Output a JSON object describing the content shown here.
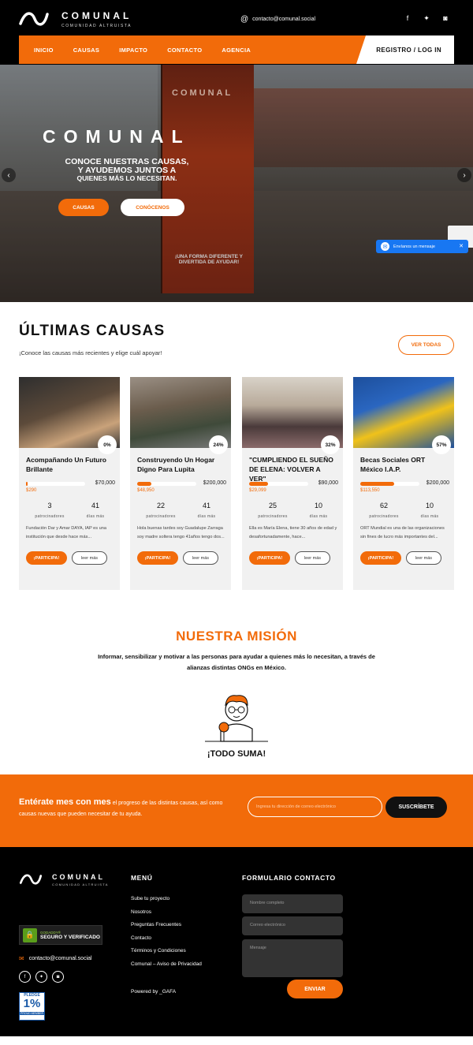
{
  "brand": {
    "name": "COMUNAL",
    "tagline": "COMUNIDAD ALTRUISTA"
  },
  "header": {
    "email": "contacto@comunal.social",
    "socials": [
      "facebook-icon",
      "twitter-icon",
      "instagram-icon"
    ]
  },
  "nav": {
    "items": [
      "INICIO",
      "CAUSAS",
      "IMPACTO",
      "CONTACTO",
      "AGENCIA"
    ],
    "login": "REGISTRO / LOG IN"
  },
  "hero": {
    "brand": "COMUNAL",
    "title_line1": "CONOCE NUESTRAS CAUSAS,",
    "title_line2": "Y AYUDEMOS JUNTOS A",
    "title_line3": "QUIENES MÁS LO NECESITAN.",
    "btn_causas": "CAUSAS",
    "btn_conocenos": "CONÓCENOS",
    "banner_text": "¡UNA FORMA DIFERENTE Y DIVERTIDA DE AYUDAR!"
  },
  "messenger": {
    "label": "Envíanos un mensaje"
  },
  "causes_section": {
    "title": "ÚLTIMAS CAUSAS",
    "subtitle": "¡Conoce las causas más recientes y elige cuál apoyar!",
    "see_all": "VER TODAS"
  },
  "causes": [
    {
      "title": "Acompañando Un Futuro Brillante",
      "percent": 0,
      "percent_label": "0%",
      "goal": "$70,000",
      "raised": "$290",
      "sponsors": "3",
      "sponsors_label": "patrocinadores",
      "days": "41",
      "days_label": "días más",
      "desc": "Fundación Dar y Amar DAYA, IAP es una institución que desde hace más...",
      "btn_participa": "¡PARTICIPA!",
      "btn_leer": "leer más"
    },
    {
      "title": "Construyendo Un Hogar Digno Para Lupita",
      "percent": 24,
      "percent_label": "24%",
      "goal": "$200,000",
      "raised": "$48,950",
      "sponsors": "22",
      "sponsors_label": "patrocinadores",
      "days": "41",
      "days_label": "días más",
      "desc": "Hola buenas tardes soy Guadalupe Zarraga soy madre soltera tengo 41años tengo dos...",
      "btn_participa": "¡PARTICIPA!",
      "btn_leer": "leer más"
    },
    {
      "title": "\"CUMPLIENDO EL SUEÑO DE ELENA: VOLVER A VER\"",
      "percent": 32,
      "percent_label": "32%",
      "goal": "$90,000",
      "raised": "$29,099",
      "sponsors": "25",
      "sponsors_label": "patrocinadores",
      "days": "10",
      "days_label": "días más",
      "desc": "Ella es María Elena, tiene 30 años de edad y desafortunadamente, hace...",
      "btn_participa": "¡PARTICIPA!",
      "btn_leer": "leer más"
    },
    {
      "title": "Becas Sociales ORT México I.A.P.",
      "percent": 57,
      "percent_label": "57%",
      "goal": "$200,000",
      "raised": "$113,550",
      "sponsors": "62",
      "sponsors_label": "patrocinadores",
      "days": "10",
      "days_label": "días más",
      "desc": "ORT Mundial es una de las organizaciones sin fines de lucro más importantes del...",
      "btn_participa": "¡PARTICIPA!",
      "btn_leer": "leer más"
    }
  ],
  "mission": {
    "title": "NUESTRA MISIÓN",
    "text": "Informar, sensibilizar y motivar a las personas para ayudar a quienes más lo necesitan, a través de alianzas distintas ONGs en México.",
    "slogan": "¡TODO SUMA!"
  },
  "subscribe": {
    "lead": "Entérate mes con mes",
    "text": " el progreso de las distintas causas, así como causas nuevas que pueden necesitar de tu ayuda.",
    "placeholder": "Ingresa tu dirección de correo electrónico",
    "button": "SUSCRÍBETE"
  },
  "footer": {
    "godaddy_top": "GODADDY®",
    "godaddy_main": "SEGURO Y VERIFICADO",
    "email": "contacto@comunal.social",
    "socials": [
      "facebook-icon",
      "twitter-icon",
      "instagram-icon"
    ],
    "pledge_top": "PLEDGE",
    "pledge_main": "1%",
    "pledge_bottom": "PROUD MEMBER",
    "menu_title": "MENÚ",
    "menu": [
      "Sube tu proyecto",
      "Nosotros",
      "Preguntas Frecuentes",
      "Contacto",
      "Términos y Condiciones",
      "Comunal – Aviso de Privacidad"
    ],
    "powered": "Powered by _GAFA",
    "form_title": "FORMULARIO CONTACTO",
    "form_name": "Nombre completo",
    "form_email": "Correo electrónico",
    "form_msg": "Mensaje",
    "form_btn": "ENVIAR"
  },
  "colors": {
    "accent": "#f26b0a",
    "dark": "#000000",
    "card": "#f1f1f1"
  }
}
